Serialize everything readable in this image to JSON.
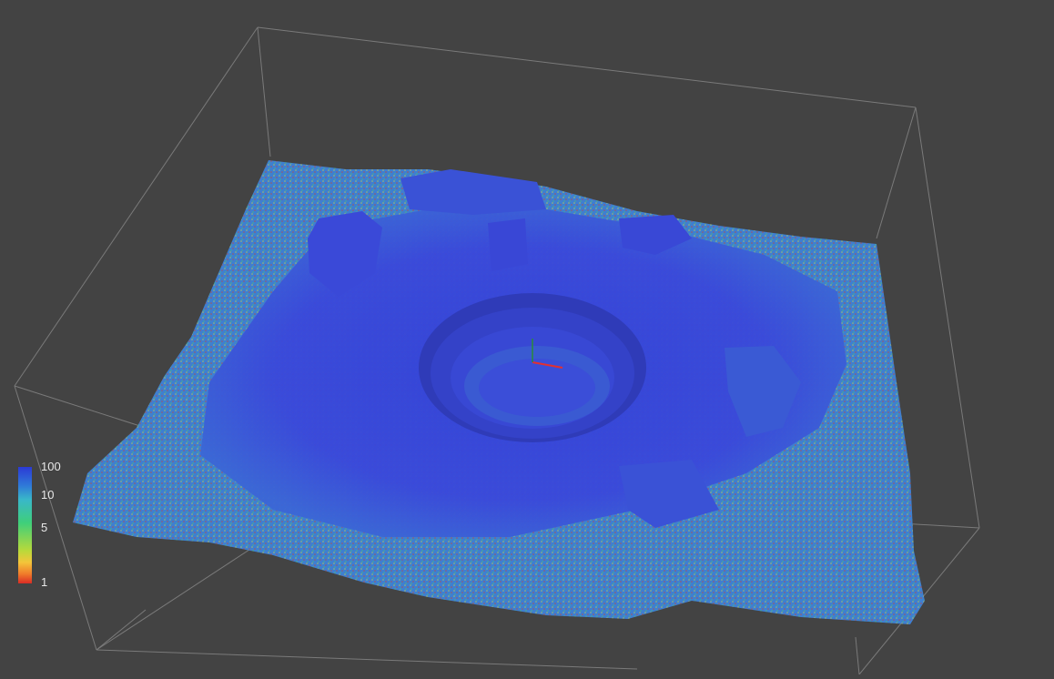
{
  "viewer": {
    "background_color": "#434343",
    "bounding_box_color": "#7d7d7d"
  },
  "legend": {
    "labels": [
      "100",
      "10",
      "5",
      "1"
    ],
    "colors": [
      "#2b3ad6",
      "#39b7c9",
      "#3fcf7a",
      "#f4c53a",
      "#d92c25"
    ]
  }
}
